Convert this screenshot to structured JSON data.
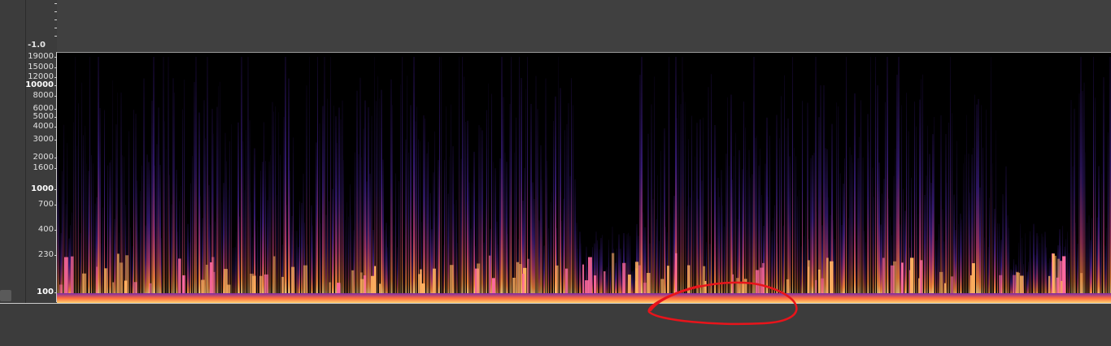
{
  "waveform": {
    "scale_label": "-1.0"
  },
  "frequency_axis": {
    "labels": [
      {
        "text": "19000",
        "hz": 19000
      },
      {
        "text": "15000",
        "hz": 15000
      },
      {
        "text": "12000",
        "hz": 12000
      },
      {
        "text": "10000",
        "hz": 10000
      },
      {
        "text": "8000",
        "hz": 8000
      },
      {
        "text": "6000",
        "hz": 6000
      },
      {
        "text": "5000",
        "hz": 5000
      },
      {
        "text": "4000",
        "hz": 4000
      },
      {
        "text": "3000",
        "hz": 3000
      },
      {
        "text": "2000",
        "hz": 2000
      },
      {
        "text": "1600",
        "hz": 1600
      },
      {
        "text": "1000",
        "hz": 1000
      },
      {
        "text": "700",
        "hz": 700
      },
      {
        "text": "400",
        "hz": 400
      },
      {
        "text": "230",
        "hz": 230
      },
      {
        "text": "100",
        "hz": 100
      }
    ],
    "major": [
      "10000",
      "1000",
      "100"
    ]
  },
  "colors": {
    "background": "#3c3c3c",
    "spectrogram_low": "#000000",
    "spectrogram_mid": "#5b2db8",
    "spectrogram_high": "#ff7a3c",
    "spectrogram_peak": "#ffe08a",
    "annotation": "#e8141b"
  },
  "annotation": {
    "shape": "hand-drawn-ellipse",
    "color": "#e8141b"
  }
}
